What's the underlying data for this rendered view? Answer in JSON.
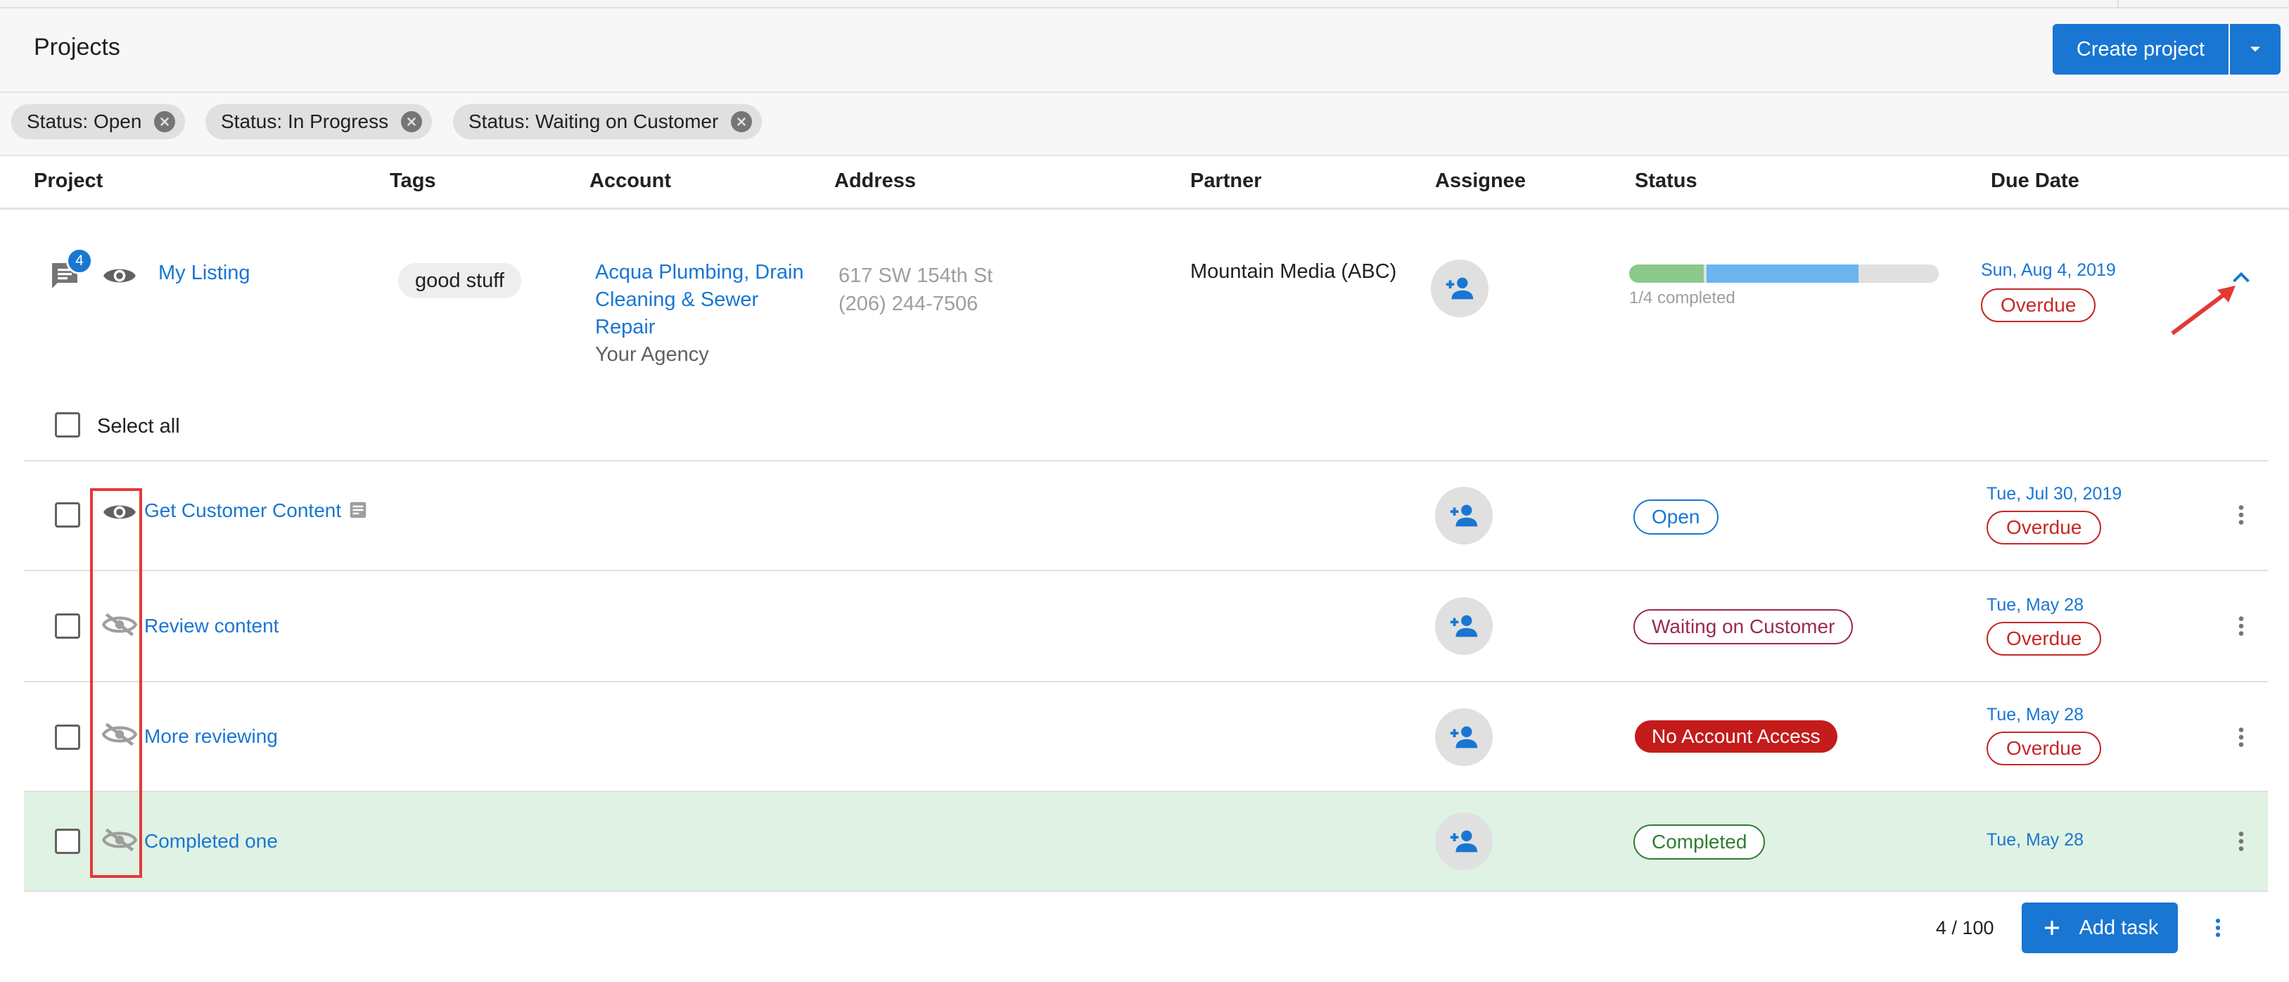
{
  "header": {
    "title": "Projects",
    "create_label": "Create project"
  },
  "filters": [
    {
      "label": "Status: Open"
    },
    {
      "label": "Status: In Progress"
    },
    {
      "label": "Status: Waiting on Customer"
    }
  ],
  "columns": [
    "Project",
    "Tags",
    "Account",
    "Address",
    "Partner",
    "Assignee",
    "Status",
    "Due Date"
  ],
  "project": {
    "name": "My Listing",
    "comment_count": "4",
    "tag": "good stuff",
    "account_lines": [
      "Acqua Plumbing, Drain",
      "Cleaning & Sewer",
      "Repair"
    ],
    "agency": "Your Agency",
    "address_line1": "617 SW 154th St",
    "address_line2": "(206) 244-7506",
    "partner": "Mountain Media (ABC)",
    "progress_text": "1/4 completed",
    "progress_fraction": 0.25,
    "due_date": "Sun, Aug 4, 2019",
    "due_status": "Overdue"
  },
  "select_all_label": "Select all",
  "tasks": [
    {
      "name": "Get Customer Content",
      "status": "Open",
      "due_date": "Tue, Jul 30, 2019",
      "due_status": "Overdue",
      "visible": true
    },
    {
      "name": "Review content",
      "status": "Waiting on Customer",
      "due_date": "Tue, May 28",
      "due_status": "Overdue",
      "visible": false
    },
    {
      "name": "More reviewing",
      "status": "No Account Access",
      "due_date": "Tue, May 28",
      "due_status": "Overdue",
      "visible": false
    },
    {
      "name": "Completed one",
      "status": "Completed",
      "due_date": "Tue, May 28",
      "due_status": "",
      "visible": false
    }
  ],
  "footer": {
    "count": "4 / 100",
    "add_task_label": "Add task"
  },
  "colors": {
    "accent": "#1976d2",
    "overdue": "#c62828",
    "waiting": "#9c2a4e",
    "no_access": "#c41b1b",
    "completed": "#2e7d32",
    "completed_row": "#e0f2e3",
    "progress_green": "#8bc88b",
    "progress_blue": "#6ab4f0",
    "annotation_red": "#e53935"
  },
  "icons": {
    "comment": "comment-icon",
    "visible": "eye-icon",
    "hidden": "eye-off-icon",
    "assign": "person-add-icon",
    "collapse": "chevron-up-icon",
    "menu": "more-vert-icon",
    "add": "plus-icon"
  }
}
